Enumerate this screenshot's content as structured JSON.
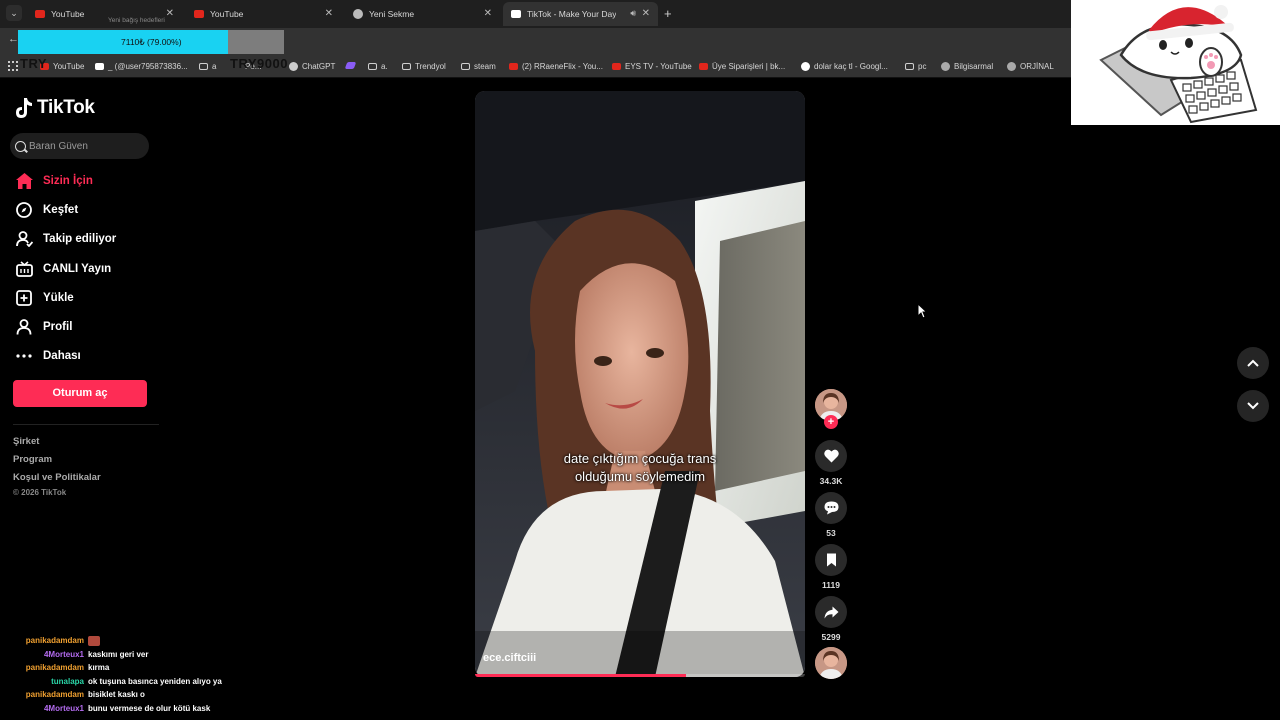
{
  "browser": {
    "tabs": [
      {
        "title": "YouTube",
        "icon": "youtube-icon",
        "active": false
      },
      {
        "title": "YouTube",
        "icon": "youtube-icon",
        "active": false
      },
      {
        "title": "Yeni Sekme",
        "icon": "chrome-icon",
        "active": false
      },
      {
        "title": "TikTok - Make Your Day",
        "icon": "tiktok-icon",
        "active": true
      }
    ],
    "bookmarks": [
      {
        "label": "YouTube",
        "icon": "youtube-icon"
      },
      {
        "label": "_ (@user795873836...",
        "icon": "tiktok-icon"
      },
      {
        "label": "a",
        "icon": "folder-icon"
      },
      {
        "label": "Pe...",
        "icon": "folder-icon"
      },
      {
        "label": "ChatGPT",
        "icon": "chatgpt-icon"
      },
      {
        "label": "a.",
        "icon": "folder-icon"
      },
      {
        "label": "Trendyol",
        "icon": "folder-icon"
      },
      {
        "label": "steam",
        "icon": "folder-icon"
      },
      {
        "label": "(2) RRaeneFlix - You...",
        "icon": "youtube-icon"
      },
      {
        "label": "EYS TV - YouTube",
        "icon": "youtube-icon"
      },
      {
        "label": "Üye Siparişleri | bk...",
        "icon": "youtube-icon"
      },
      {
        "label": "dolar kaç tl - Googl...",
        "icon": "google-icon"
      },
      {
        "label": "pc",
        "icon": "folder-icon"
      },
      {
        "label": "Bilgisarmal",
        "icon": "globe-icon"
      },
      {
        "label": "ORJİNAL",
        "icon": "globe-icon"
      }
    ]
  },
  "overlay": {
    "donation_caption": "Yeni bağış hedefleri",
    "donation_text": "7110₺ (79.00%)",
    "donation_progress": 0.79,
    "try_left": "TRY",
    "try_right": "TRY9000"
  },
  "tiktok": {
    "logo": "TikTok",
    "search_placeholder": "Baran Güven",
    "nav": [
      {
        "label": "Sizin İçin",
        "icon": "home-icon",
        "active": true
      },
      {
        "label": "Keşfet",
        "icon": "compass-icon",
        "active": false
      },
      {
        "label": "Takip ediliyor",
        "icon": "following-icon",
        "active": false
      },
      {
        "label": "CANLI Yayın",
        "icon": "live-icon",
        "active": false
      },
      {
        "label": "Yükle",
        "icon": "upload-icon",
        "active": false
      },
      {
        "label": "Profil",
        "icon": "profile-icon",
        "active": false
      },
      {
        "label": "Dahası",
        "icon": "more-icon",
        "active": false
      }
    ],
    "login_button": "Oturum aç",
    "footer": [
      "Şirket",
      "Program",
      "Koşul ve Politikalar"
    ],
    "copyright": "© 2026 TikTok"
  },
  "video": {
    "caption_line1": "date çıktığım çocuğa trans",
    "caption_line2": "olduğumu söylemedim",
    "username": "ece.ciftciii",
    "progress": 0.64,
    "likes": "34.3K",
    "comments": "53",
    "saves": "1119",
    "shares": "5299"
  },
  "chat": [
    {
      "user": "panikadamdam",
      "color": "#f0a030",
      "message": ""
    },
    {
      "user": "4Morteux1",
      "color": "#b46cf0",
      "message": "kaskımı geri ver"
    },
    {
      "user": "panikadamdam",
      "color": "#f0a030",
      "message": "kırma"
    },
    {
      "user": "tunalapa",
      "color": "#2ad6a8",
      "message": "ok tuşuna basınca yeniden alıyo ya"
    },
    {
      "user": "panikadamdam",
      "color": "#f0a030",
      "message": "bisiklet kaskı o"
    },
    {
      "user": "4Morteux1",
      "color": "#b46cf0",
      "message": "bunu vermese de olur kötü kask"
    }
  ],
  "colors": {
    "accent": "#fe2c55",
    "background": "#000000",
    "donation_fill": "#19d2f2"
  }
}
